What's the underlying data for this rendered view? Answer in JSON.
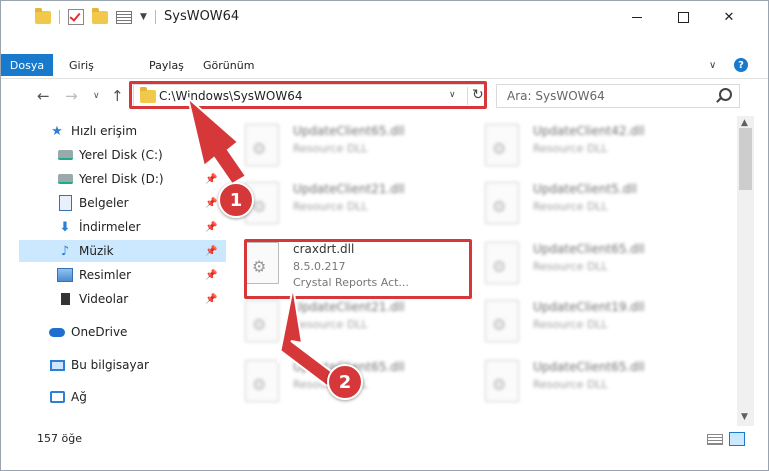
{
  "window": {
    "title": "SysWOW64",
    "help_label": "?"
  },
  "ribbon": {
    "tabs": [
      {
        "label": "Dosya"
      },
      {
        "label": "Giriş"
      },
      {
        "label": "Paylaş"
      },
      {
        "label": "Görünüm"
      }
    ]
  },
  "address": {
    "path": "C:\\Windows\\SysWOW64",
    "search_placeholder": "Ara: SysWOW64"
  },
  "sidebar": {
    "quick_access": "Hızlı erişim",
    "items": [
      {
        "label": "Yerel Disk (C:)"
      },
      {
        "label": "Yerel Disk (D:)"
      },
      {
        "label": "Belgeler"
      },
      {
        "label": "İndirmeler"
      },
      {
        "label": "Müzik"
      },
      {
        "label": "Resimler"
      },
      {
        "label": "Videolar"
      }
    ],
    "onedrive": "OneDrive",
    "this_pc": "Bu bilgisayar",
    "network": "Ağ"
  },
  "files": [
    {
      "name": "UpdateClient65.dll",
      "desc": "Resource DLL"
    },
    {
      "name": "UpdateClient42.dll",
      "desc": "Resource DLL"
    },
    {
      "name": "UpdateClient21.dll",
      "desc": "Resource DLL"
    },
    {
      "name": "UpdateClient5.dll",
      "desc": "Resource DLL"
    },
    {
      "name": "craxdrt.dll",
      "version": "8.5.0.217",
      "desc": "Crystal Reports Act..."
    },
    {
      "name": "UpdateClient65.dll",
      "desc": "Resource DLL"
    },
    {
      "name": "UpdateClient21.dll",
      "desc": "Resource DLL"
    },
    {
      "name": "UpdateClient19.dll",
      "desc": "Resource DLL"
    },
    {
      "name": "UpdateClient65.dll",
      "desc": "Resource DLL"
    },
    {
      "name": "UpdateClient65.dll",
      "desc": "Resource DLL"
    }
  ],
  "status": {
    "count": "157 öğe"
  },
  "annotations": {
    "step1": "1",
    "step2": "2"
  }
}
